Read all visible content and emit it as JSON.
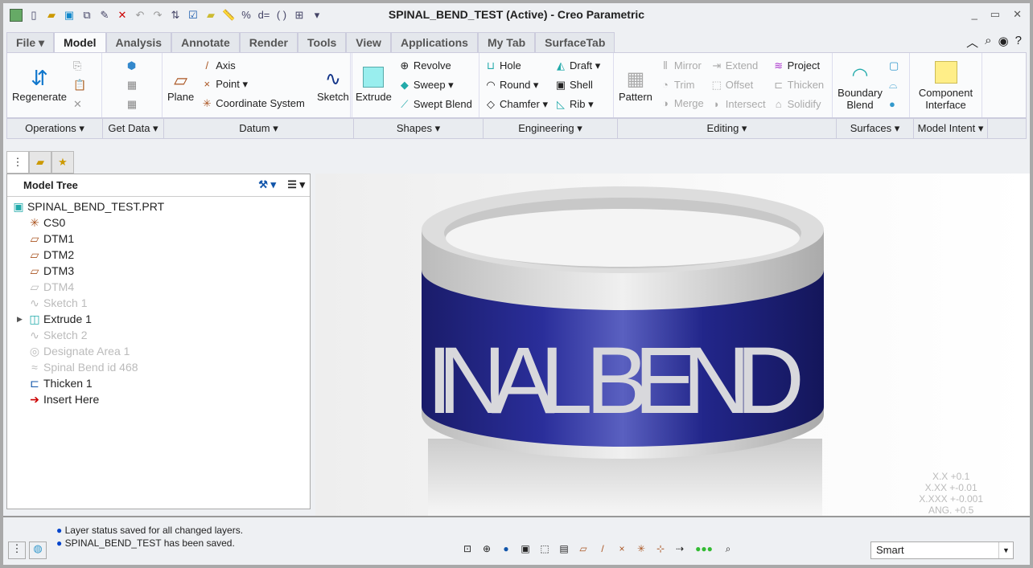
{
  "window": {
    "title": "SPINAL_BEND_TEST (Active) - Creo Parametric"
  },
  "tabs": [
    "File",
    "Model",
    "Analysis",
    "Annotate",
    "Render",
    "Tools",
    "View",
    "Applications",
    "My Tab",
    "SurfaceTab"
  ],
  "ribbon": {
    "operations": {
      "regenerate": "Regenerate"
    },
    "datum": {
      "plane": "Plane",
      "axis": "Axis",
      "point": "Point",
      "csys": "Coordinate System",
      "sketch": "Sketch"
    },
    "shapes": {
      "extrude": "Extrude",
      "revolve": "Revolve",
      "sweep": "Sweep",
      "swept_blend": "Swept Blend"
    },
    "engineering": {
      "hole": "Hole",
      "round": "Round",
      "chamfer": "Chamfer",
      "draft": "Draft",
      "shell": "Shell",
      "rib": "Rib"
    },
    "editing": {
      "pattern": "Pattern",
      "mirror": "Mirror",
      "trim": "Trim",
      "merge": "Merge",
      "extend": "Extend",
      "offset": "Offset",
      "intersect": "Intersect",
      "project": "Project",
      "thicken": "Thicken",
      "solidify": "Solidify"
    },
    "surfaces": {
      "boundary_blend": "Boundary Blend"
    },
    "model_intent": {
      "component_interface": "Component Interface"
    },
    "groups": [
      "Operations",
      "Get Data",
      "Datum",
      "Shapes",
      "Engineering",
      "Editing",
      "Surfaces",
      "Model Intent"
    ]
  },
  "model_tree": {
    "title": "Model Tree",
    "items": [
      {
        "label": "SPINAL_BEND_TEST.PRT",
        "state": "normal"
      },
      {
        "label": "CS0",
        "state": "normal"
      },
      {
        "label": "DTM1",
        "state": "normal"
      },
      {
        "label": "DTM2",
        "state": "normal"
      },
      {
        "label": "DTM3",
        "state": "normal"
      },
      {
        "label": "DTM4",
        "state": "suppressed"
      },
      {
        "label": "Sketch 1",
        "state": "suppressed"
      },
      {
        "label": "Extrude 1",
        "state": "normal"
      },
      {
        "label": "Sketch 2",
        "state": "suppressed"
      },
      {
        "label": "Designate Area 1",
        "state": "suppressed"
      },
      {
        "label": "Spinal Bend id 468",
        "state": "suppressed"
      },
      {
        "label": "Thicken 1",
        "state": "normal"
      },
      {
        "label": "Insert Here",
        "state": "normal"
      }
    ]
  },
  "viewport": {
    "model_text": "INAL BEND",
    "tolerances": [
      "X.X +0.1",
      "X.XX +-0.01",
      "X.XXX +-0.001",
      "ANG. +0.5"
    ]
  },
  "status": {
    "messages": [
      "Layer status saved for all changed layers.",
      "SPINAL_BEND_TEST has been saved."
    ],
    "filter": "Smart"
  }
}
